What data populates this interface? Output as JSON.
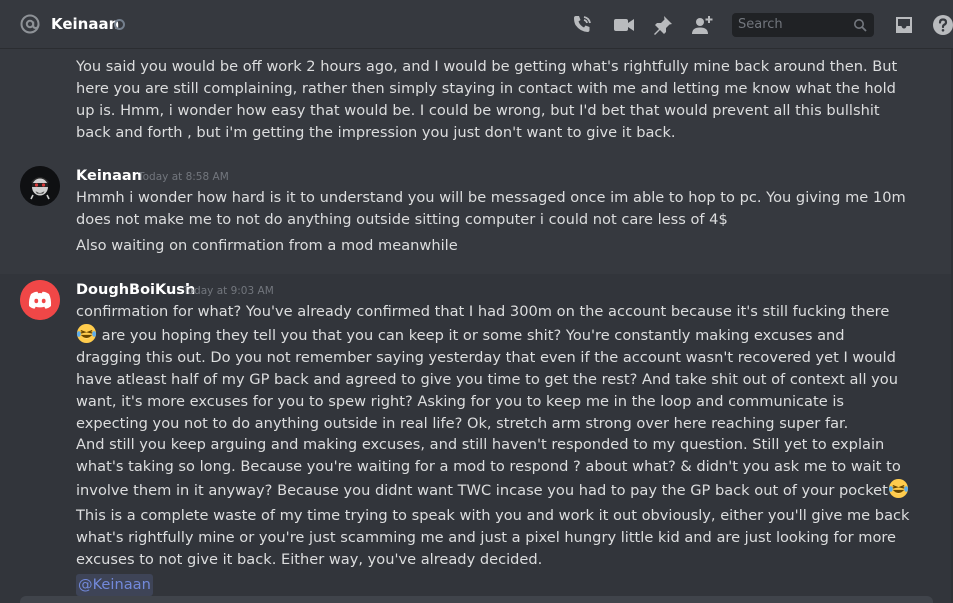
{
  "header": {
    "channel_name": "Keinaan",
    "search_placeholder": "Search"
  },
  "icons": {
    "header": [
      "at-icon",
      "status-dot",
      "phone-call-icon",
      "video-camera-icon",
      "pin-icon",
      "add-user-icon",
      "search-icon",
      "inbox-icon",
      "help-icon"
    ],
    "emoji": "laughing-tears-emoji"
  },
  "colors": {
    "background": "#36393f",
    "search_background": "#202225",
    "discord_avatar": "#f04747",
    "mention": "#7289da",
    "username": "#ffffff",
    "timestamp": "#72767d"
  },
  "messages": {
    "m0": {
      "text": "You said you would be off work 2 hours ago, and I would be getting what's rightfully mine back around then. But here you are still complaining, rather then simply staying in contact with me and letting me know what the hold up is. Hmm, i wonder how easy that would be. I could be wrong, but I'd bet that would prevent all this bullshit back and forth , but i'm getting the impression you just don't want to give it back."
    },
    "m1": {
      "author": "Keinaan",
      "timestamp": "Today at 8:58 AM",
      "line1": "Hmmh i wonder how hard is it to understand you will be messaged once im able to hop to pc. You giving me 10m does not make me to not do anything outside sitting computer i could not care less of 4$",
      "line2": "Also waiting on confirmation from a mod meanwhile"
    },
    "m2": {
      "author": "DoughBoiKush",
      "timestamp": "Today at 9:03 AM",
      "p1a": "confirmation for what? You've already confirmed that I had 300m on the account because it's still fucking there ",
      "p1b": " are you hoping they tell you that you can keep it or some shit? You're constantly making excuses and dragging this out. Do you not remember saying yesterday that even if the account wasn't recovered yet I would have atleast half of my GP back and agreed to give you time to get the rest? And take shit out of context all you want, it's more excuses for you to spew right? Asking for you to keep me in the loop and communicate is expecting you not to do anything outside in real life? Ok, stretch arm strong over here reaching super far.",
      "p2": "And still you keep arguing and making excuses, and still haven't responded to my question. Still yet to explain what's taking so long. Because you're waiting for a mod to respond ? about what? & didn't you ask me to wait to involve them in it anyway? Because you didnt want TWC incase you had to pay the GP back out of your pocket",
      "p3": "This is a complete waste of my time trying to speak with you and work it out obviously, either you'll give me back what's rightfully mine or you're just scamming me and just a pixel hungry little kid and are just looking for more excuses to not give it back. Either way, you've already decided.",
      "mention": "@Keinaan"
    }
  }
}
